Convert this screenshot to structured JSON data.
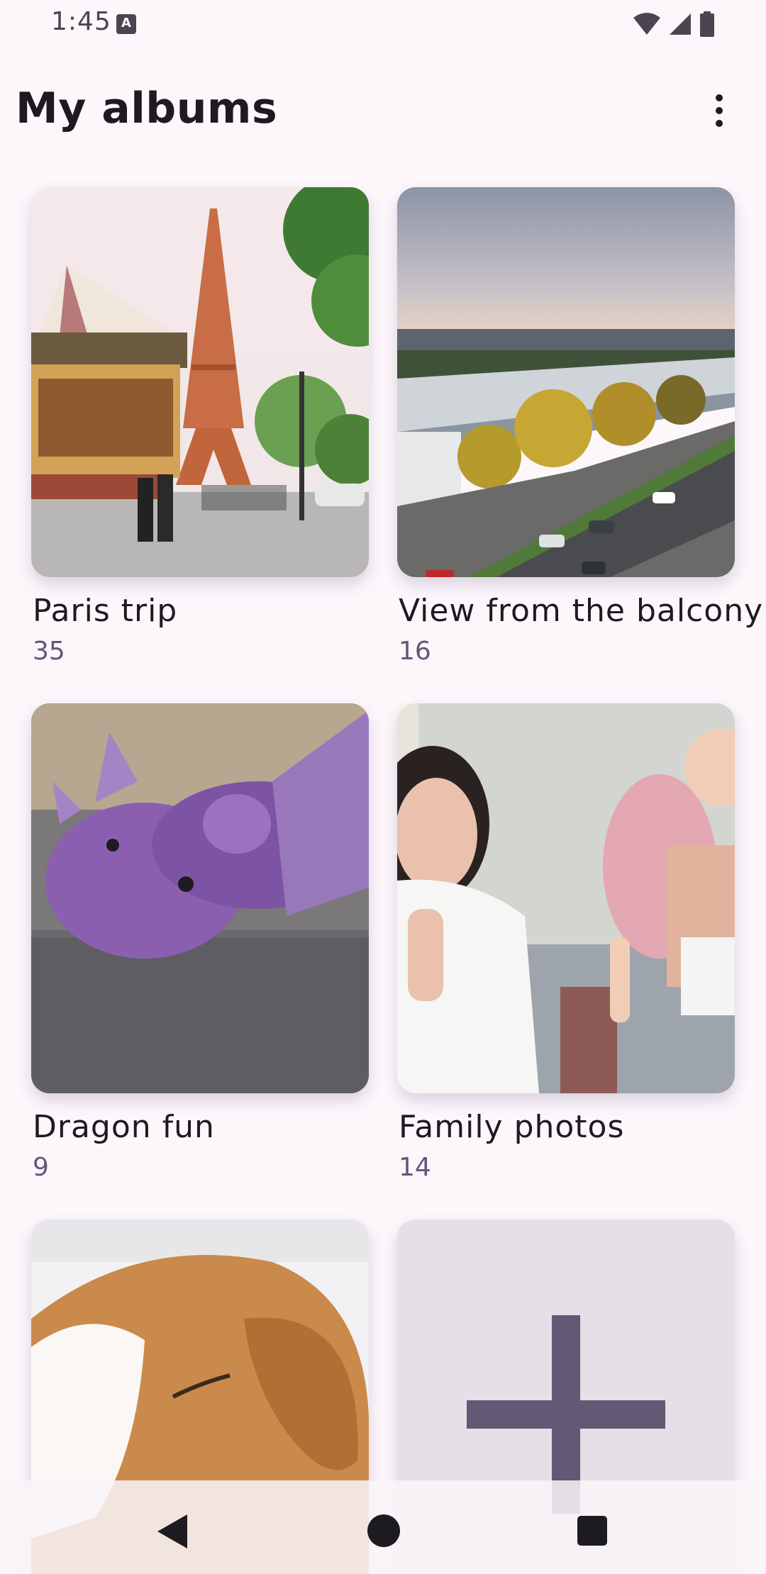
{
  "status_bar": {
    "time": "1:45",
    "icons": [
      "keyboard-a-icon",
      "wifi-icon",
      "cellular-icon",
      "battery-icon"
    ]
  },
  "app_bar": {
    "title": "My albums",
    "menu_icon": "more-vert-icon"
  },
  "albums": [
    {
      "name": "Paris trip",
      "count": "35",
      "image": "eiffel-tower-carousel-photo"
    },
    {
      "name": "View from the balcony",
      "count": "16",
      "image": "city-street-balcony-photo"
    },
    {
      "name": "Dragon fun",
      "count": "9",
      "image": "purple-crochet-dragon-photo"
    },
    {
      "name": "Family photos",
      "count": "14",
      "image": "mother-and-baby-photo"
    },
    {
      "name": "",
      "count": "",
      "image": "sleeping-puppy-photo"
    }
  ],
  "add_album": {
    "icon": "plus-icon"
  },
  "nav_bar": {
    "icons": [
      "back-icon",
      "home-icon",
      "recents-icon"
    ]
  },
  "colors": {
    "background": "#fdf7fc",
    "count_text": "#62577a",
    "add_tile": "#e6dfe8",
    "add_icon": "#625a74"
  }
}
